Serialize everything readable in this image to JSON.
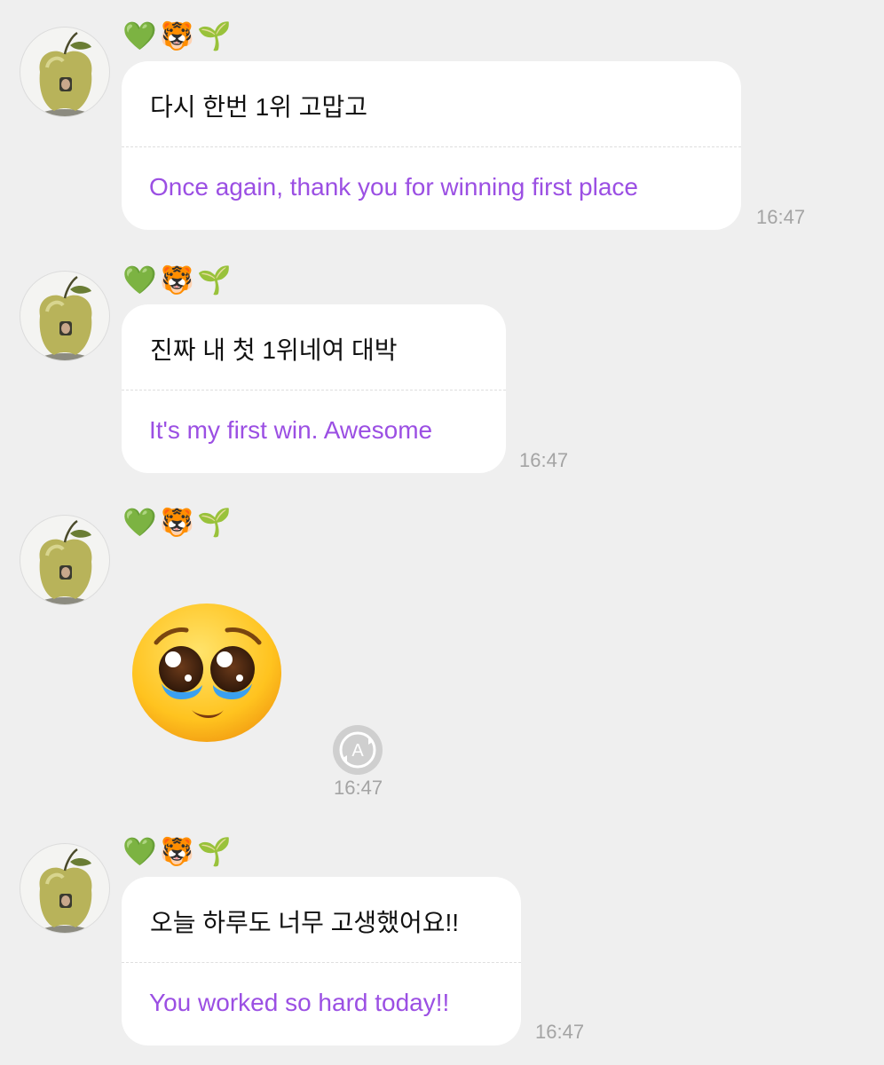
{
  "messages": [
    {
      "sender_emojis": [
        "💚",
        "🐯",
        "🌱"
      ],
      "original": "다시 한번 1위 고맙고",
      "translation": "Once again, thank you for winning first place",
      "time": "16:47"
    },
    {
      "sender_emojis": [
        "💚",
        "🐯",
        "🌱"
      ],
      "original": "진짜 내 첫 1위네여 대박",
      "translation": "It's my first win. Awesome",
      "time": "16:47"
    },
    {
      "sender_emojis": [
        "💚",
        "🐯",
        "🌱"
      ],
      "emoji_name": "pleading-face-emoji",
      "translate_icon": "A",
      "time": "16:47"
    },
    {
      "sender_emojis": [
        "💚",
        "🐯",
        "🌱"
      ],
      "original": "오늘 하루도 너무 고생했어요!!",
      "translation": "You worked so hard today!!",
      "time": "16:47"
    }
  ],
  "colors": {
    "background": "#efefef",
    "bubble": "#ffffff",
    "translation_text": "#9b4fe3",
    "timestamp": "#a4a4a4"
  }
}
